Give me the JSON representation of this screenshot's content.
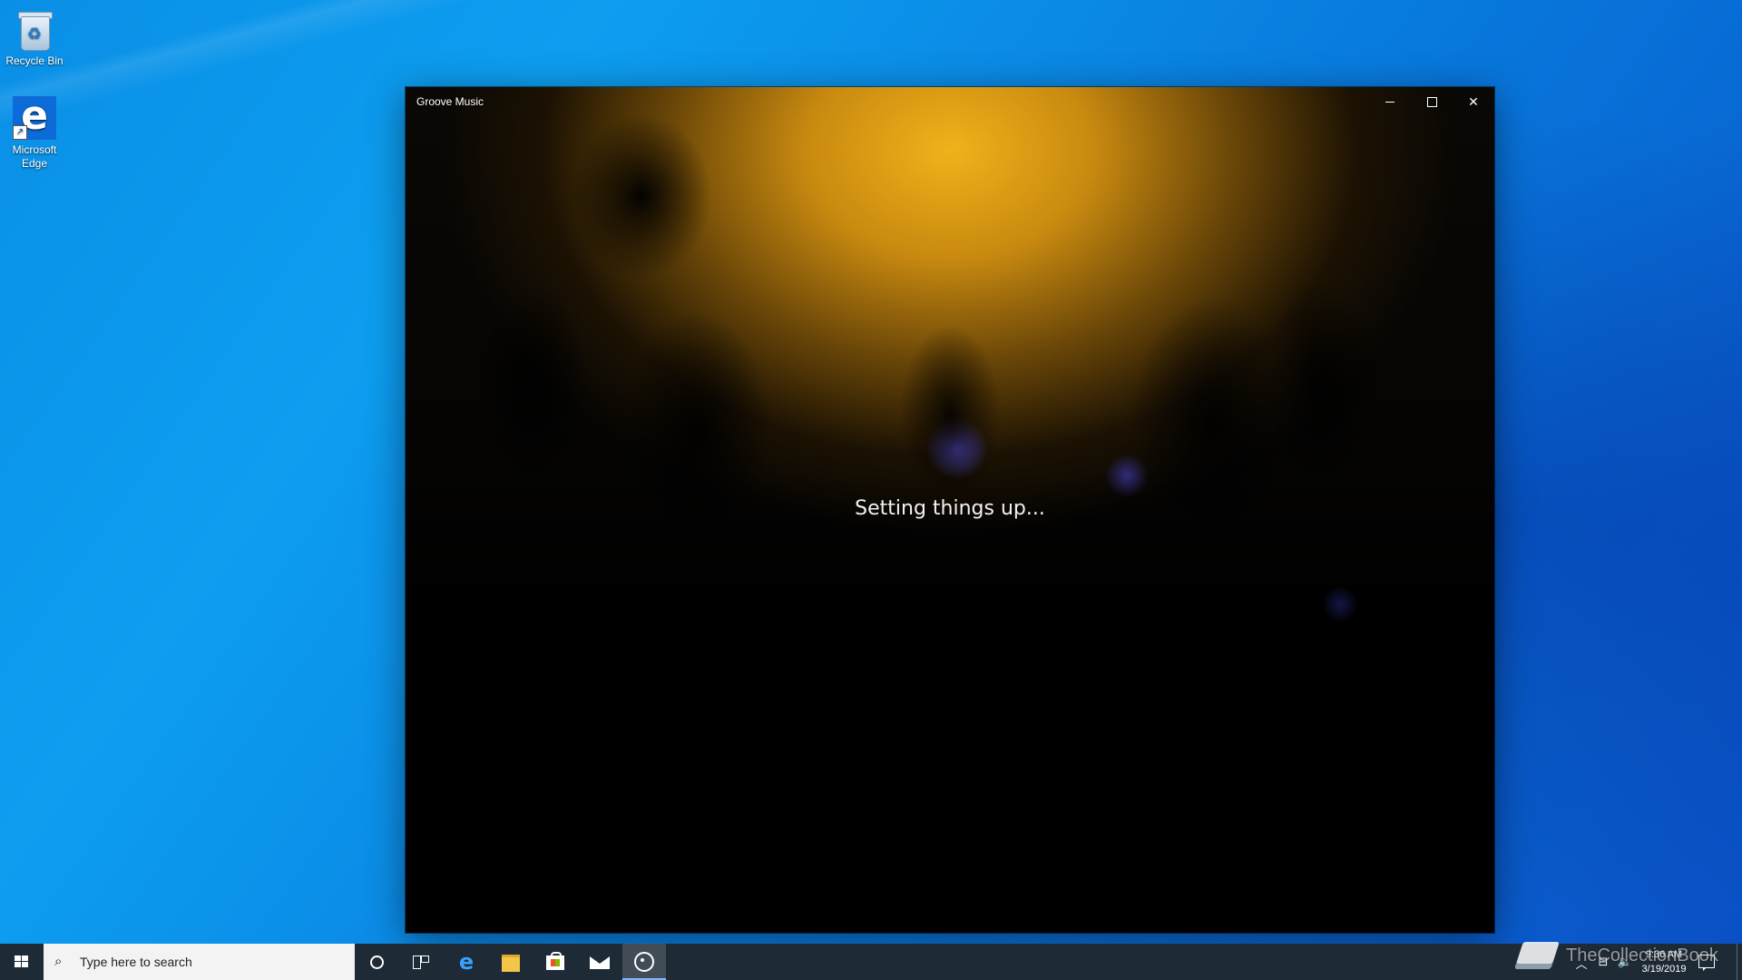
{
  "desktop": {
    "icons": [
      {
        "label": "Recycle Bin",
        "icon": "recycle-bin-icon"
      },
      {
        "label": "Microsoft Edge",
        "icon": "edge-icon"
      }
    ]
  },
  "window": {
    "title": "Groove Music",
    "status": "Setting things up...",
    "controls": {
      "minimize": "minimize-icon",
      "maximize": "maximize-icon",
      "close": "close-icon"
    }
  },
  "taskbar": {
    "search_placeholder": "Type here to search",
    "pinned": [
      "cortana-icon",
      "task-view-icon",
      "edge-icon",
      "file-explorer-icon",
      "store-icon",
      "mail-icon",
      "groove-music-icon"
    ],
    "active_app": "Groove Music",
    "clock": {
      "time": "9:36 AM",
      "date": "3/19/2019"
    }
  },
  "watermark": "TheCollectionBook",
  "colors": {
    "desktop": "#0a8fe6",
    "taskbar": "#1e2a36",
    "search_bg": "#f3f3f3",
    "art_glow": "#f0b21a"
  }
}
